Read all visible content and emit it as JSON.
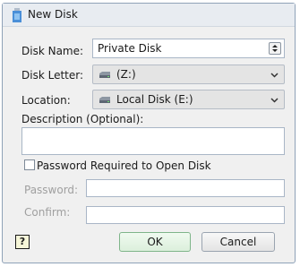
{
  "window": {
    "title": "New Disk"
  },
  "form": {
    "disk_name_label": "Disk Name:",
    "disk_name_value": "Private Disk",
    "disk_letter_label": "Disk Letter:",
    "disk_letter_value": "(Z:)",
    "location_label": "Location:",
    "location_value": "Local Disk (E:)",
    "description_label": "Description (Optional):",
    "description_value": "",
    "password_required_label": "Password Required to Open Disk",
    "password_required_checked": false,
    "password_label": "Password:",
    "confirm_label": "Confirm:"
  },
  "buttons": {
    "help": "?",
    "ok": "OK",
    "cancel": "Cancel"
  },
  "icons": {
    "title": "disk-app-icon",
    "drive": "hard-drive-icon",
    "dropdown": "chevron-down-icon",
    "spin": "spin-updown-icon",
    "help": "help-icon"
  }
}
